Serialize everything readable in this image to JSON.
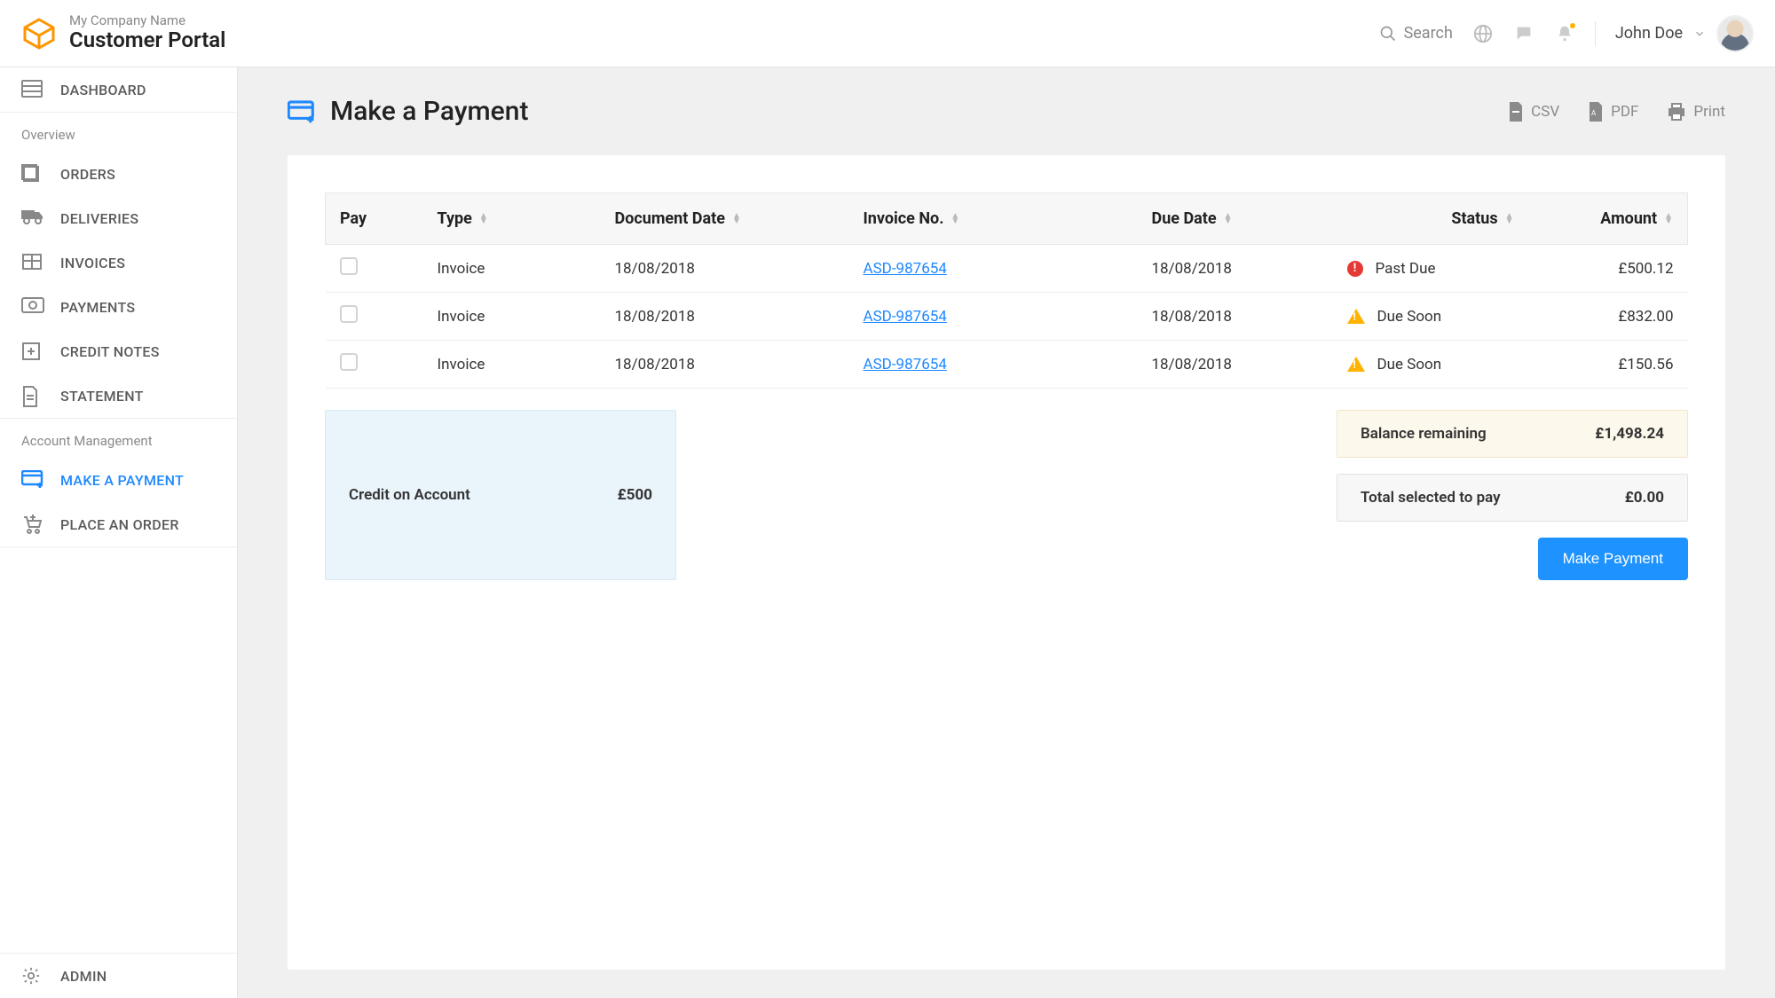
{
  "brand": {
    "small": "My Company Name",
    "large": "Customer Portal"
  },
  "topbar": {
    "search_label": "Search",
    "user_name": "John Doe"
  },
  "sidebar": {
    "dashboard": "Dashboard",
    "section_overview": "Overview",
    "items_overview": [
      "Orders",
      "Deliveries",
      "Invoices",
      "Payments",
      "Credit Notes",
      "Statement"
    ],
    "section_account": "Account Management",
    "items_account": [
      "Make a Payment",
      "Place an Order"
    ],
    "admin": "Admin"
  },
  "page": {
    "title": "Make a Payment",
    "exports": {
      "csv": "CSV",
      "pdf": "PDF",
      "print": "Print"
    }
  },
  "table": {
    "headers": {
      "pay": "Pay",
      "type": "Type",
      "doc_date": "Document Date",
      "invoice_no": "Invoice No.",
      "due_date": "Due Date",
      "status": "Status",
      "amount": "Amount"
    },
    "rows": [
      {
        "type": "Invoice",
        "doc_date": "18/08/2018",
        "invoice_no": "ASD-987654",
        "due_date": "18/08/2018",
        "status_kind": "past",
        "status": "Past Due",
        "amount": "£500.12"
      },
      {
        "type": "Invoice",
        "doc_date": "18/08/2018",
        "invoice_no": "ASD-987654",
        "due_date": "18/08/2018",
        "status_kind": "soon",
        "status": "Due Soon",
        "amount": "£832.00"
      },
      {
        "type": "Invoice",
        "doc_date": "18/08/2018",
        "invoice_no": "ASD-987654",
        "due_date": "18/08/2018",
        "status_kind": "soon",
        "status": "Due Soon",
        "amount": "£150.56"
      }
    ]
  },
  "summary": {
    "credit_label": "Credit on Account",
    "credit_value": "£500",
    "balance_label": "Balance remaining",
    "balance_value": "£1,498.24",
    "selected_label": "Total selected to pay",
    "selected_value": "£0.00",
    "button": "Make Payment"
  }
}
